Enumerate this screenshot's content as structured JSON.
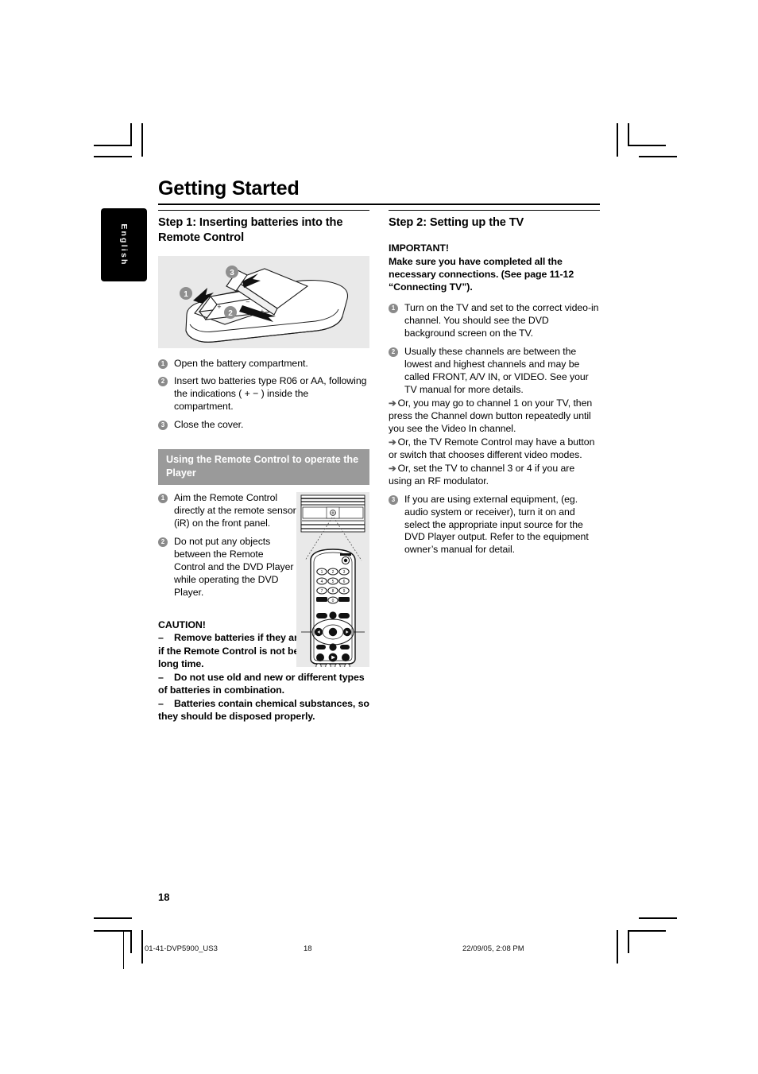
{
  "language_tab": {
    "label": "English"
  },
  "header": {
    "title": "Getting Started"
  },
  "left_column": {
    "step_heading": "Step 1:  Inserting batteries into the Remote Control",
    "illustration": {
      "name": "remote-battery-compartment-illustration",
      "callouts": [
        "1",
        "2",
        "3"
      ],
      "battery_marks": [
        "+",
        "-",
        "+",
        "-"
      ]
    },
    "steps": [
      {
        "num": "1",
        "text": "Open the battery compartment."
      },
      {
        "num": "2",
        "text": "Insert two batteries type R06 or AA, following the indications ( + − ) inside the compartment."
      },
      {
        "num": "3",
        "text": "Close the cover."
      }
    ],
    "banner": "Using the Remote Control to operate the Player",
    "remote_steps": [
      {
        "num": "1",
        "text": "Aim the Remote Control directly at the remote sensor (iR) on the front panel."
      },
      {
        "num": "2",
        "text": "Do not put any objects between the Remote Control and the DVD Player while operating the DVD Player."
      }
    ],
    "remote_illustration": {
      "name": "remote-aiming-at-ir-sensor-illustration",
      "keypad_labels": [
        "1",
        "2",
        "3",
        "4",
        "5",
        "6",
        "7",
        "8",
        "9",
        "0"
      ]
    },
    "caution": {
      "title": "CAUTION!",
      "items": [
        "Remove batteries if they are exhausted or if the Remote Control is not being used for a long time.",
        "Do not use old and new or different types of batteries in combination.",
        "Batteries contain chemical substances, so they should be disposed properly."
      ]
    }
  },
  "right_column": {
    "step_heading": "Step 2:   Setting up the TV",
    "important_title": "IMPORTANT!",
    "important_body": "Make sure you have completed all the necessary connections. (See page 11-12 “Connecting TV”).",
    "steps": [
      {
        "num": "1",
        "text": "Turn on the TV and set to the correct video-in channel. You should see the DVD background screen on the TV.",
        "notes": []
      },
      {
        "num": "2",
        "text": "Usually these channels are between the lowest and highest channels and may be called FRONT, A/V IN, or VIDEO. See your TV manual for more details.",
        "notes": [
          "Or, you may go to channel 1 on your TV, then press the Channel down button repeatedly until you see the Video In channel.",
          "Or, the TV Remote Control may have a button or switch that chooses different video modes.",
          "Or, set the TV to channel 3 or 4 if you are using an RF modulator."
        ]
      },
      {
        "num": "3",
        "text": "If you are using external equipment, (eg. audio system or receiver), turn it on and select the appropriate input source for the DVD Player output. Refer to the equipment owner’s manual for detail.",
        "notes": []
      }
    ],
    "arrow_glyph": "➔"
  },
  "footer": {
    "page_number": "18",
    "file_name": "01-41-DVP5900_US3",
    "file_page": "18",
    "timestamp": "22/09/05, 2:08 PM"
  },
  "colors": {
    "banner_background": "#9a9a9a",
    "bullet_background": "#8a8a8a",
    "illustration_background": "#e9e9e9",
    "tab_background": "#000000"
  }
}
